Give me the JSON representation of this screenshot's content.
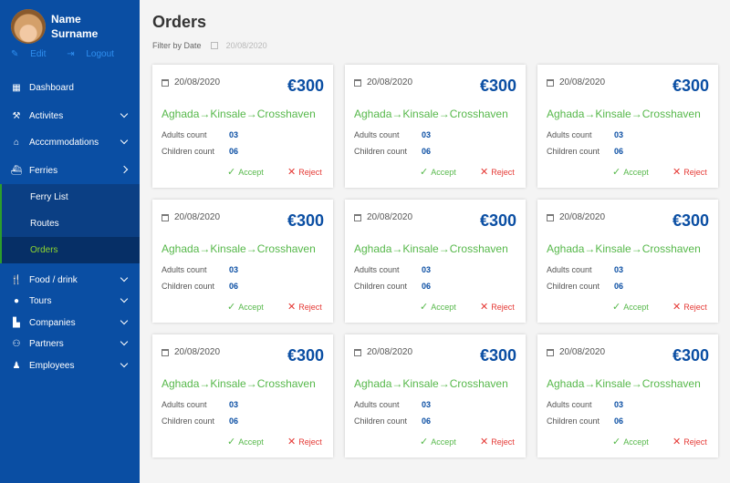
{
  "profile": {
    "name_line1": "Name",
    "name_line2": "Surname",
    "edit_label": "Edit",
    "logout_label": "Logout"
  },
  "sidebar": {
    "items": [
      {
        "label": "Dashboard",
        "icon": "grid-icon"
      },
      {
        "label": "Activites",
        "icon": "activities-icon"
      },
      {
        "label": "Acccmmodations",
        "icon": "home-icon"
      },
      {
        "label": "Ferries",
        "icon": "ship-icon"
      },
      {
        "label": "Food / drink",
        "icon": "food-icon"
      },
      {
        "label": "Tours",
        "icon": "tours-icon"
      },
      {
        "label": "Companies",
        "icon": "building-icon"
      },
      {
        "label": "Partners",
        "icon": "partners-icon"
      },
      {
        "label": "Employees",
        "icon": "employees-icon"
      }
    ],
    "ferries_sub": [
      {
        "label": "Ferry List"
      },
      {
        "label": "Routes"
      },
      {
        "label": "Orders"
      }
    ]
  },
  "main": {
    "title": "Orders",
    "filter_label": "Filter by  Date",
    "filter_date": "20/08/2020"
  },
  "orders": [
    {
      "date": "20/08/2020",
      "price": "€300",
      "route": "Aghada→Kinsale→Crosshaven",
      "adults_label": "Adults count",
      "adults": "03",
      "children_label": "Children count",
      "children": "06",
      "accept": "Accept",
      "reject": "Reject"
    },
    {
      "date": "20/08/2020",
      "price": "€300",
      "route": "Aghada→Kinsale→Crosshaven",
      "adults_label": "Adults count",
      "adults": "03",
      "children_label": "Children count",
      "children": "06",
      "accept": "Accept",
      "reject": "Reject"
    },
    {
      "date": "20/08/2020",
      "price": "€300",
      "route": "Aghada→Kinsale→Crosshaven",
      "adults_label": "Adults count",
      "adults": "03",
      "children_label": "Children count",
      "children": "06",
      "accept": "Accept",
      "reject": "Reject"
    },
    {
      "date": "20/08/2020",
      "price": "€300",
      "route": "Aghada→Kinsale→Crosshaven",
      "adults_label": "Adults count",
      "adults": "03",
      "children_label": "Children count",
      "children": "06",
      "accept": "Accept",
      "reject": "Reject"
    },
    {
      "date": "20/08/2020",
      "price": "€300",
      "route": "Aghada→Kinsale→Crosshaven",
      "adults_label": "Adults count",
      "adults": "03",
      "children_label": "Children count",
      "children": "06",
      "accept": "Accept",
      "reject": "Reject"
    },
    {
      "date": "20/08/2020",
      "price": "€300",
      "route": "Aghada→Kinsale→Crosshaven",
      "adults_label": "Adults count",
      "adults": "03",
      "children_label": "Children count",
      "children": "06",
      "accept": "Accept",
      "reject": "Reject"
    },
    {
      "date": "20/08/2020",
      "price": "€300",
      "route": "Aghada→Kinsale→Crosshaven",
      "adults_label": "Adults count",
      "adults": "03",
      "children_label": "Children count",
      "children": "06",
      "accept": "Accept",
      "reject": "Reject"
    },
    {
      "date": "20/08/2020",
      "price": "€300",
      "route": "Aghada→Kinsale→Crosshaven",
      "adults_label": "Adults count",
      "adults": "03",
      "children_label": "Children count",
      "children": "06",
      "accept": "Accept",
      "reject": "Reject"
    },
    {
      "date": "20/08/2020",
      "price": "€300",
      "route": "Aghada→Kinsale→Crosshaven",
      "adults_label": "Adults count",
      "adults": "03",
      "children_label": "Children count",
      "children": "06",
      "accept": "Accept",
      "reject": "Reject"
    }
  ],
  "colors": {
    "sidebar": "#0a4ea3",
    "accent_green": "#56b84a",
    "reject_red": "#e53935",
    "active_sub_text": "#8fd62f"
  }
}
